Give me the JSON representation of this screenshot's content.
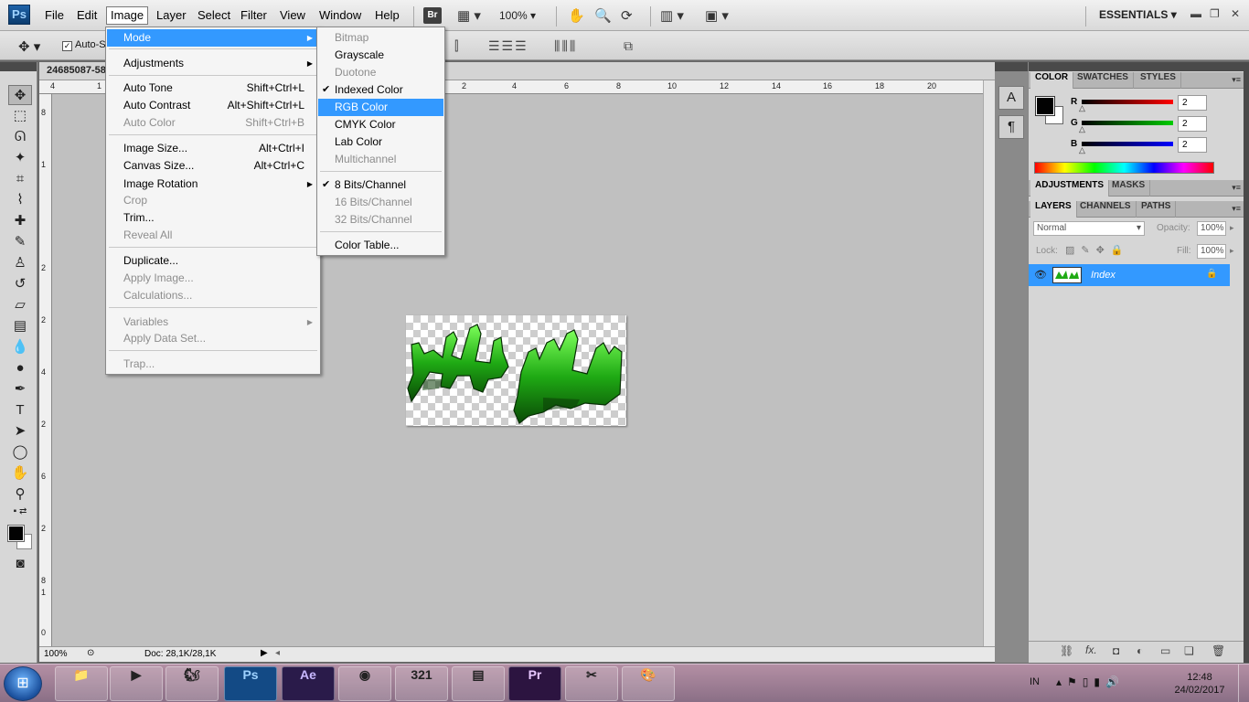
{
  "app": {
    "logo": "Ps",
    "menus": [
      "File",
      "Edit",
      "Image",
      "Layer",
      "Select",
      "Filter",
      "View",
      "Window",
      "Help"
    ],
    "active_menu": "Image",
    "bridge_label": "Br",
    "zoom": "100%",
    "workspace": "ESSENTIALS",
    "icons": [
      "hand-icon",
      "zoom-icon",
      "rotate-view-icon",
      "arrange-documents-icon",
      "screen-mode-icon"
    ]
  },
  "options_bar": {
    "auto_select_label": "Auto-S"
  },
  "document": {
    "tab_title": "24685087-58",
    "ruler_top": [
      "4",
      "1",
      "2",
      "4",
      "6",
      "8",
      "10",
      "12",
      "14",
      "16",
      "18",
      "20"
    ],
    "ruler_left": [
      "8",
      "1",
      "2",
      "2",
      "4",
      "2",
      "6",
      "2",
      "8",
      "1",
      "0",
      "1",
      "2"
    ],
    "status_zoom": "100%",
    "status_doc": "Doc: 28,1K/28,1K"
  },
  "image_menu": {
    "items": [
      {
        "label": "Mode",
        "shortcut": "",
        "submenu": true,
        "disabled": false,
        "highlighted": true
      },
      {
        "label": "Adjustments",
        "shortcut": "",
        "submenu": true,
        "disabled": false
      },
      {
        "label": "Auto Tone",
        "shortcut": "Shift+Ctrl+L",
        "disabled": false
      },
      {
        "label": "Auto Contrast",
        "shortcut": "Alt+Shift+Ctrl+L",
        "disabled": false
      },
      {
        "label": "Auto Color",
        "shortcut": "Shift+Ctrl+B",
        "disabled": true
      },
      {
        "label": "Image Size...",
        "shortcut": "Alt+Ctrl+I",
        "disabled": false
      },
      {
        "label": "Canvas Size...",
        "shortcut": "Alt+Ctrl+C",
        "disabled": false
      },
      {
        "label": "Image Rotation",
        "shortcut": "",
        "submenu": true,
        "disabled": false
      },
      {
        "label": "Crop",
        "shortcut": "",
        "disabled": true
      },
      {
        "label": "Trim...",
        "shortcut": "",
        "disabled": false
      },
      {
        "label": "Reveal All",
        "shortcut": "",
        "disabled": true
      },
      {
        "label": "Duplicate...",
        "shortcut": "",
        "disabled": false
      },
      {
        "label": "Apply Image...",
        "shortcut": "",
        "disabled": true
      },
      {
        "label": "Calculations...",
        "shortcut": "",
        "disabled": true
      },
      {
        "label": "Variables",
        "shortcut": "",
        "submenu": true,
        "disabled": true
      },
      {
        "label": "Apply Data Set...",
        "shortcut": "",
        "disabled": true
      },
      {
        "label": "Trap...",
        "shortcut": "",
        "disabled": true
      }
    ]
  },
  "mode_menu": {
    "items": [
      {
        "label": "Bitmap",
        "disabled": true,
        "checked": false
      },
      {
        "label": "Grayscale",
        "disabled": false,
        "checked": false
      },
      {
        "label": "Duotone",
        "disabled": true,
        "checked": false
      },
      {
        "label": "Indexed Color",
        "disabled": false,
        "checked": true
      },
      {
        "label": "RGB Color",
        "disabled": false,
        "checked": false,
        "highlighted": true
      },
      {
        "label": "CMYK Color",
        "disabled": false,
        "checked": false
      },
      {
        "label": "Lab Color",
        "disabled": false,
        "checked": false
      },
      {
        "label": "Multichannel",
        "disabled": true,
        "checked": false
      },
      {
        "label": "8 Bits/Channel",
        "disabled": false,
        "checked": true
      },
      {
        "label": "16 Bits/Channel",
        "disabled": true,
        "checked": false
      },
      {
        "label": "32 Bits/Channel",
        "disabled": true,
        "checked": false
      },
      {
        "label": "Color Table...",
        "disabled": false,
        "checked": false
      }
    ]
  },
  "color_panel": {
    "tabs": [
      "COLOR",
      "SWATCHES",
      "STYLES"
    ],
    "channels": [
      {
        "label": "R",
        "value": "2",
        "color": "#ff0000"
      },
      {
        "label": "G",
        "value": "2",
        "color": "#00cc00"
      },
      {
        "label": "B",
        "value": "2",
        "color": "#0000ff"
      }
    ],
    "foreground": "#020202",
    "background": "#ffffff"
  },
  "adjustments_panel": {
    "tabs": [
      "ADJUSTMENTS",
      "MASKS"
    ]
  },
  "layers_panel": {
    "tabs": [
      "LAYERS",
      "CHANNELS",
      "PATHS"
    ],
    "blend_mode": "Normal",
    "opacity_label": "Opacity:",
    "opacity": "100%",
    "lock_label": "Lock:",
    "fill_label": "Fill:",
    "fill": "100%",
    "layers": [
      {
        "name": "Index",
        "visible": true,
        "locked": true
      }
    ]
  },
  "taskbar": {
    "apps": [
      "Explorer",
      "Media",
      "UC Browser",
      "Ps",
      "AE",
      "Chrome",
      "321",
      "Notes",
      "Pr",
      "Snipping",
      "Paint"
    ],
    "tray_lang": "IN",
    "time": "12:48",
    "date": "24/02/2017"
  }
}
